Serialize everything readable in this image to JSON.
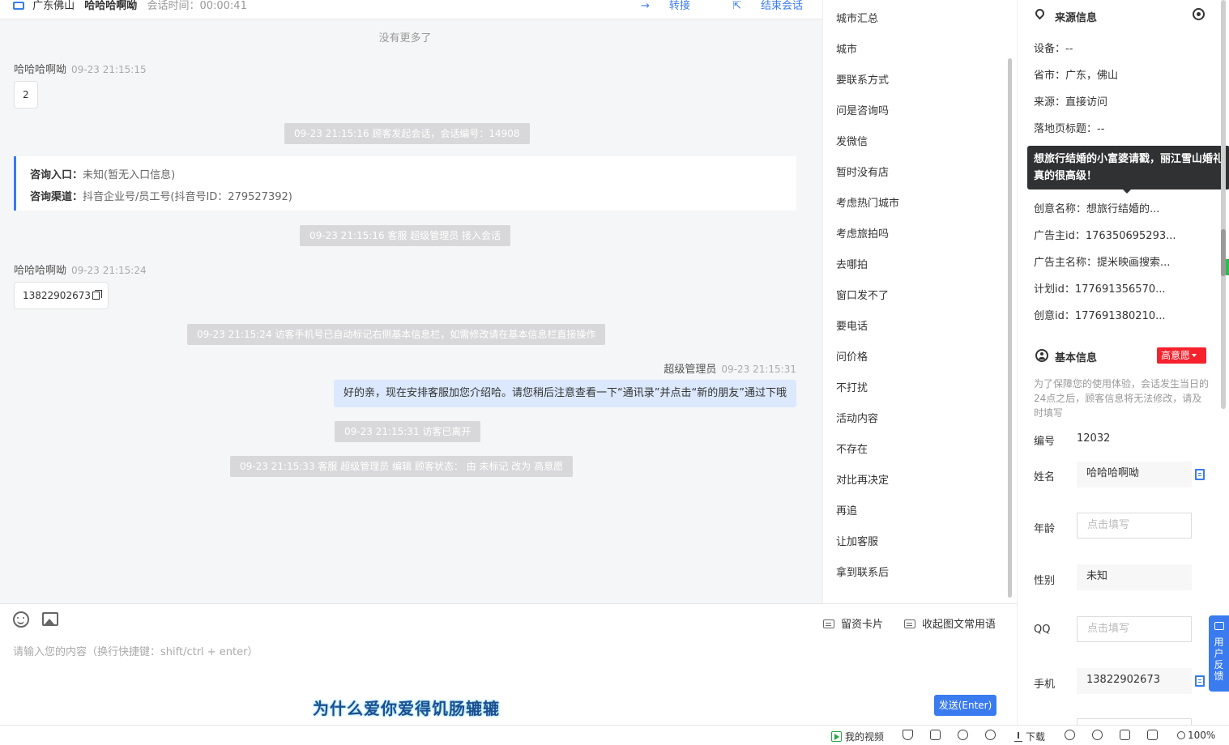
{
  "header": {
    "location": "广东佛山",
    "visitor_name": "哈哈哈啊呦",
    "session_time": "会话时间：00:00:41",
    "transfer": "转接",
    "end_session": "结束会话"
  },
  "chat": {
    "no_more": "没有更多了",
    "messages": [
      {
        "sender": "哈哈哈啊呦",
        "time": "09-23 21:15:15",
        "text": "2"
      },
      {
        "sender": "哈哈哈啊呦",
        "time": "09-23 21:15:24",
        "text": "13822902673"
      },
      {
        "sender": "超级管理员",
        "time": "09-23 21:15:31",
        "text": "好的亲，现在安排客服加您介绍哈。请您稍后注意查看一下“通讯录”并点击“新的朋友”通过下哦"
      }
    ],
    "system": [
      "09-23 21:15:16 顾客发起会话，会话编号：14908",
      "09-23 21:15:16 客服 超级管理员 接入会话",
      "09-23 21:15:24 访客手机号已自动标记右侧基本信息栏，如需修改请在基本信息栏直接操作",
      "09-23 21:15:31 访客已离开",
      "09-23 21:15:33 客服 超级管理员 编辑 顾客状态： 由 未标记 改为 高意愿"
    ],
    "info_card": {
      "entry_label": "咨询入口：",
      "entry_value": "未知(暂无入口信息)",
      "channel_label": "咨询渠道：",
      "channel_value": "抖音企业号/员工号(抖音号ID：279527392)"
    }
  },
  "quick_replies": [
    "城市汇总",
    "城市",
    "要联系方式",
    "问是咨询吗",
    "发微信",
    "暂时没有店",
    "考虑热门城市",
    "考虑旅拍吗",
    "去哪拍",
    "窗口发不了",
    "要电话",
    "问价格",
    "不打扰",
    "活动内容",
    "不存在",
    "对比再决定",
    "再追",
    "让加客服",
    "拿到联系后"
  ],
  "input": {
    "card_btn": "留资卡片",
    "collapse_btn": "收起图文常用语",
    "placeholder": "请输入您的内容（换行快捷键：shift/ctrl + enter）",
    "send": "发送(Enter)",
    "subtitle": "为什么爱你爱得饥肠辘辘"
  },
  "source_info": {
    "title": "来源信息",
    "rows": [
      "设备：--",
      "省市：广东，佛山",
      "来源：直接访问",
      "落地页标题：--",
      "创意名称：想旅行结婚的...",
      "广告主id：176350695293...",
      "广告主名称：提米映画搜索...",
      "计划id：177691356570...",
      "创意id：177691380210..."
    ],
    "tooltip": "想旅行结婚的小富婆请戳，丽江雪山婚礼真的很高级！"
  },
  "basic_info": {
    "title": "基本信息",
    "intent": "高意愿",
    "notice": "为了保障您的使用体验，会话发生当日的24点之后，顾客信息将无法修改，请及时填写",
    "id_label": "编号",
    "id_value": "12032",
    "name_label": "姓名",
    "name_value": "哈哈哈啊呦",
    "age_label": "年龄",
    "gender_label": "性别",
    "gender_value": "未知",
    "qq_label": "QQ",
    "phone_label": "手机",
    "phone_value": "13822902673",
    "fill_placeholder": "点击填写"
  },
  "feedback": "用户反馈",
  "statusbar": {
    "my_video": "我的视频",
    "download": "下载",
    "zoom": "100%"
  }
}
